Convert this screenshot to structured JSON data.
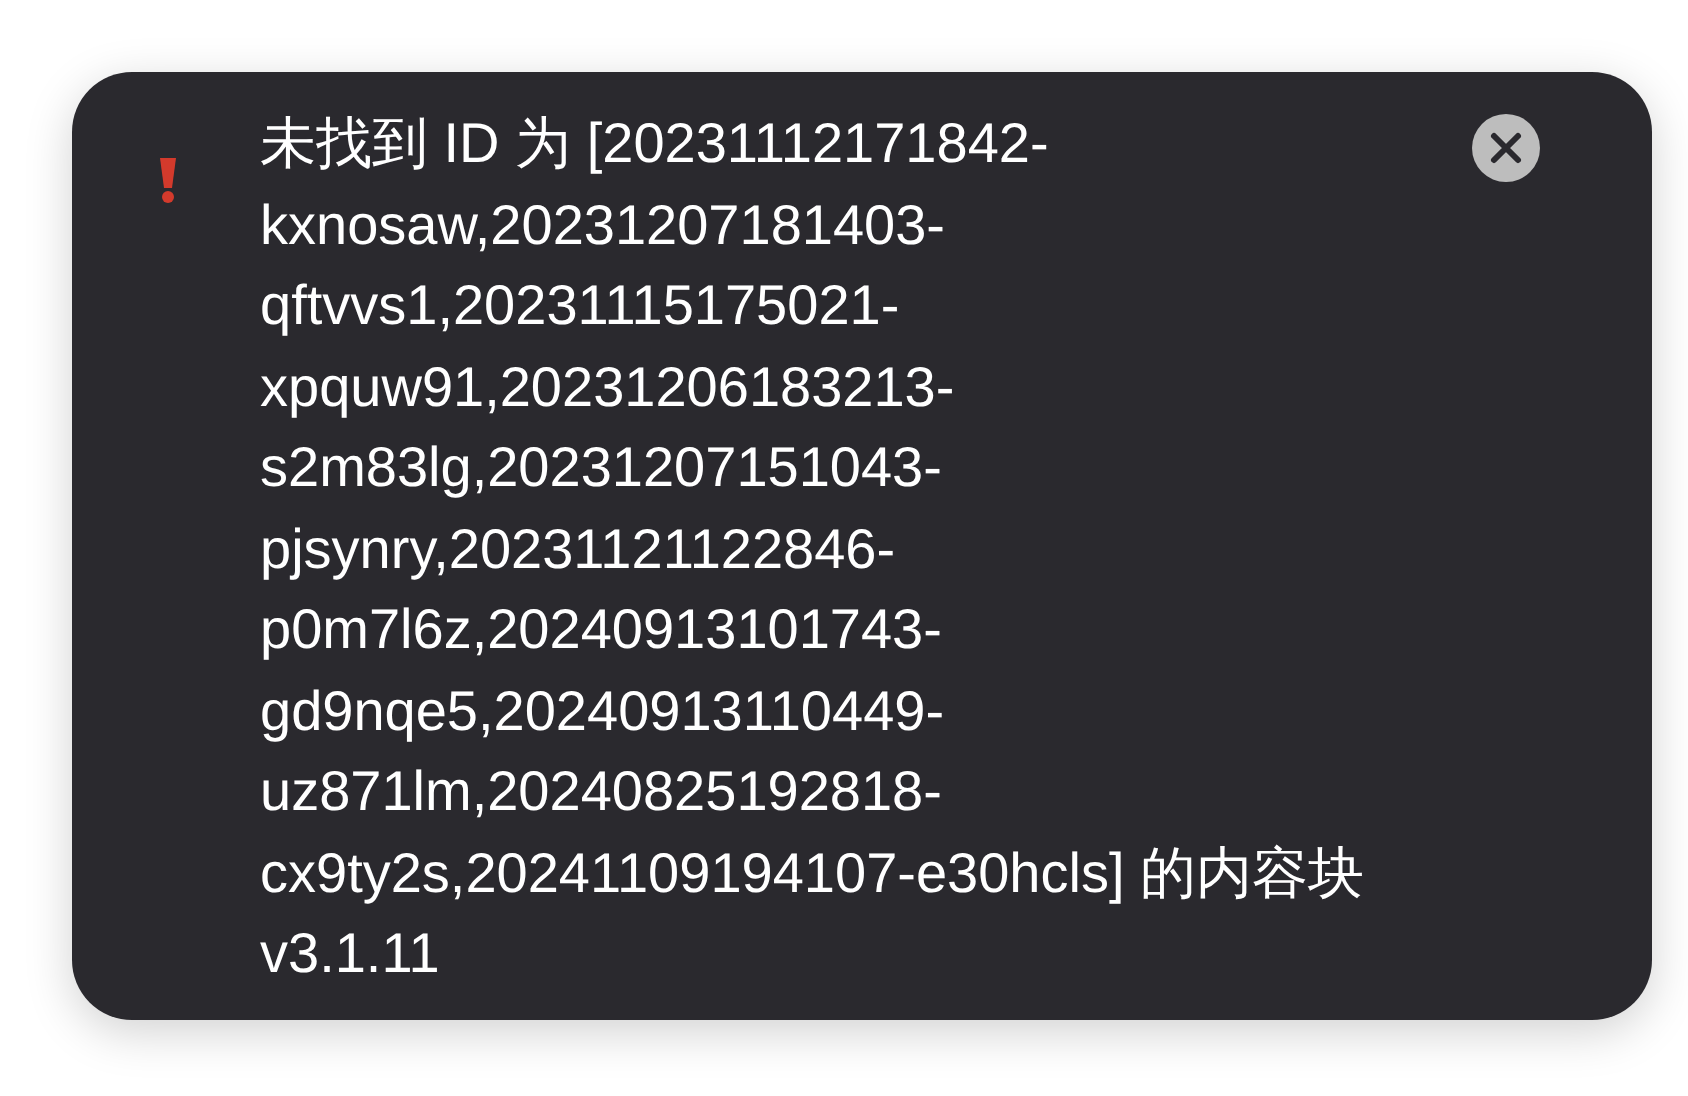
{
  "notification": {
    "message": "未找到 ID 为 [20231112171842-kxnosaw,20231207181403-qftvvs1,20231115175021-xpquw91,20231206183213-s2m83lg,20231207151043-pjsynry,20231121122846-p0m7l6z,20240913101743-gd9nqe5,20240913110449-uz871lm,20240825192818-cx9ty2s,20241109194107-e30hcls] 的内容块",
    "version": "v3.1.11"
  }
}
